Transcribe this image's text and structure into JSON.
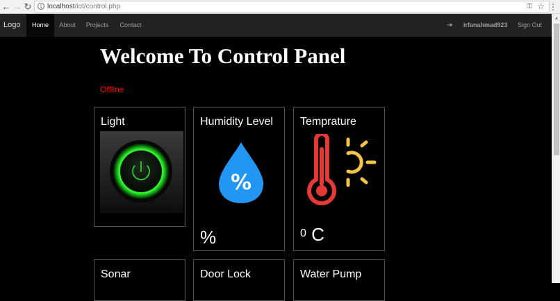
{
  "browser": {
    "url_host": "localhost",
    "url_path": "/iot/control.php"
  },
  "navbar": {
    "brand": "Logo",
    "items": [
      {
        "label": "Home",
        "active": true
      },
      {
        "label": "About"
      },
      {
        "label": "Projects"
      },
      {
        "label": "Contact"
      }
    ],
    "user": "irfanahmad923",
    "signout": "Sign Out"
  },
  "main": {
    "title": "Welcome To Control Panel",
    "status": "Offline",
    "status_color": "#ff0000"
  },
  "cards": {
    "light": {
      "title": "Light",
      "icon": "power-button-icon",
      "glow_color": "#22dd22"
    },
    "humidity": {
      "title": "Humidity Level",
      "icon": "water-drop-icon",
      "value": "%",
      "icon_color": "#2196f3"
    },
    "temperature": {
      "title": "Temprature",
      "icon": "thermometer-sun-icon",
      "value_sup": "0",
      "value_unit": "C",
      "thermo_color": "#e53935",
      "sun_color": "#f5c542"
    },
    "sonar": {
      "title": "Sonar"
    },
    "door": {
      "title": "Door Lock"
    },
    "pump": {
      "title": "Water Pump"
    }
  }
}
